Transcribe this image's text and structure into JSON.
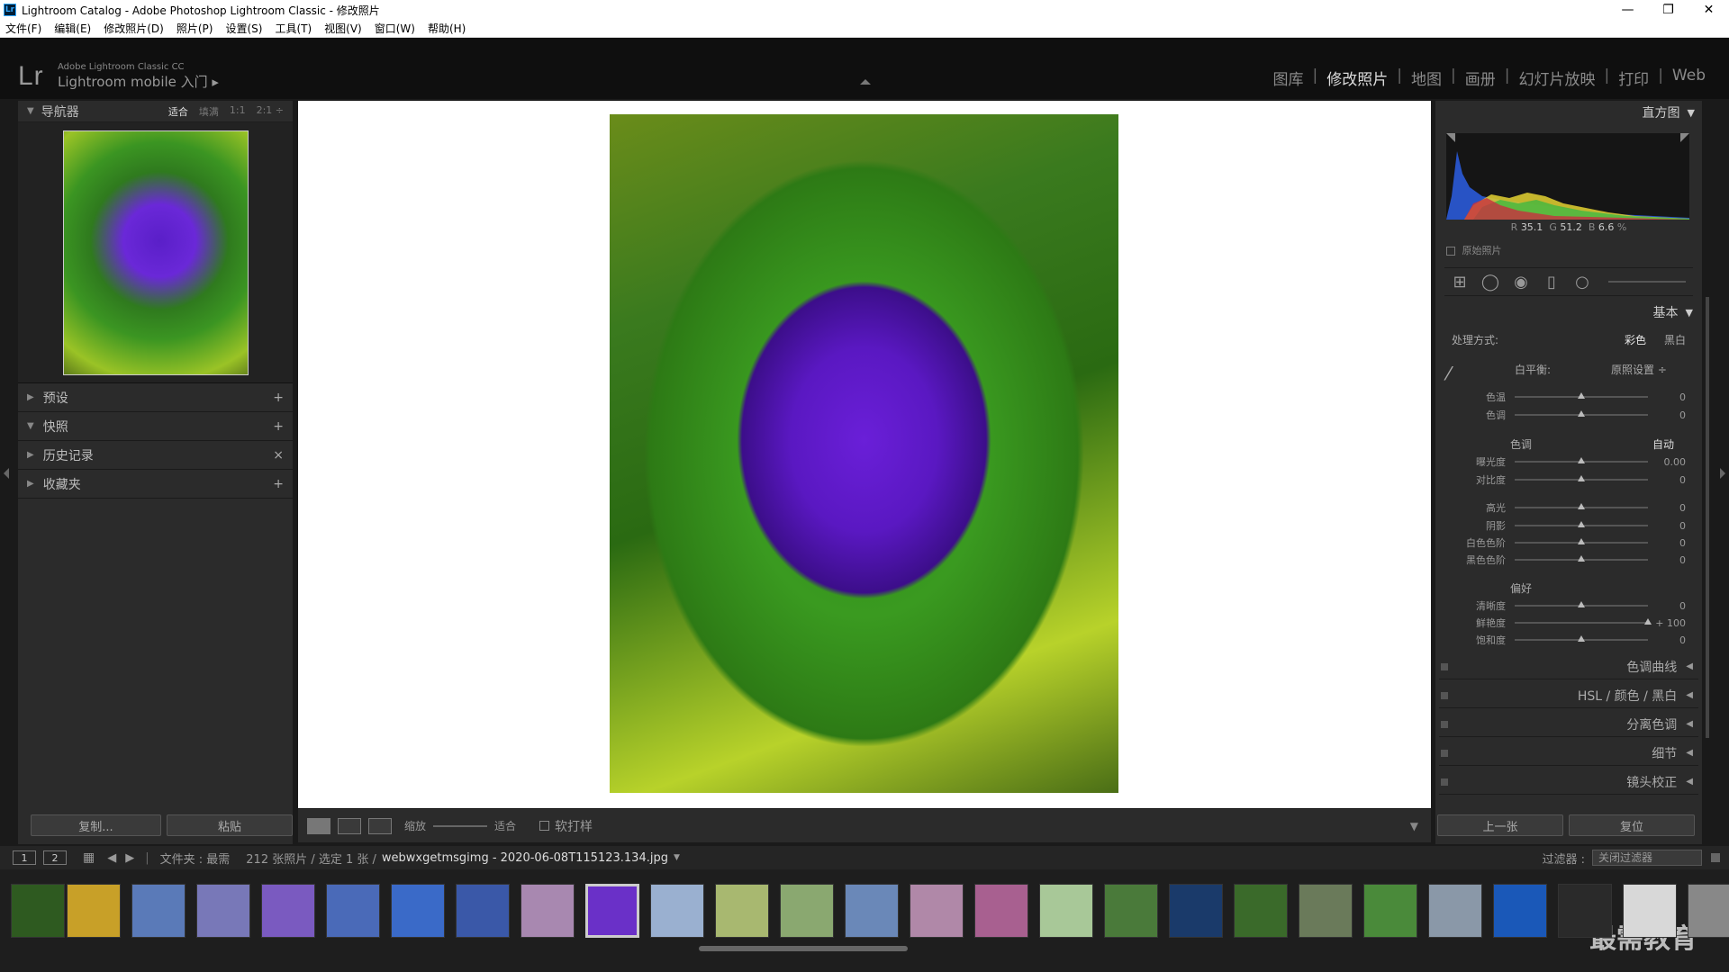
{
  "window": {
    "title": "Lightroom Catalog - Adobe Photoshop Lightroom Classic - 修改照片",
    "icon": "Lr",
    "controls": [
      "—",
      "❐",
      "✕"
    ]
  },
  "menu": [
    "文件(F)",
    "编辑(E)",
    "修改照片(D)",
    "照片(P)",
    "设置(S)",
    "工具(T)",
    "视图(V)",
    "窗口(W)",
    "帮助(H)"
  ],
  "identity": {
    "logo": "Lr",
    "line1": "Adobe Lightroom Classic CC",
    "line2": "Lightroom mobile 入门 ▸"
  },
  "modules": [
    "图库",
    "修改照片",
    "地图",
    "画册",
    "幻灯片放映",
    "打印",
    "Web"
  ],
  "active_module": "修改照片",
  "left": {
    "navigator": {
      "label": "导航器",
      "options": [
        "适合",
        "填满",
        "1:1",
        "2:1 ÷"
      ],
      "selected": "适合"
    },
    "panels": [
      {
        "label": "预设",
        "action": "+"
      },
      {
        "label": "快照",
        "action": "+"
      },
      {
        "label": "历史记录",
        "action": "×"
      },
      {
        "label": "收藏夹",
        "action": "+"
      }
    ],
    "copy_label": "复制...",
    "paste_label": "粘贴"
  },
  "toolbar": {
    "zoom_label": "缩放",
    "fit_label": "适合",
    "softproof_label": "软打样",
    "view_buttons": [
      "▭",
      "R|R",
      "Y|Y"
    ]
  },
  "right": {
    "histogram_label": "直方图",
    "hist_values": {
      "r_label": "R",
      "r": "35.1",
      "g_label": "G",
      "g": "51.2",
      "b_label": "B",
      "b": "6.6",
      "unit": "%"
    },
    "original_photo": "原始照片",
    "basic_label": "基本",
    "treatment_label": "处理方式:",
    "treatment_opts": [
      "彩色",
      "黑白"
    ],
    "treatment_selected": "彩色",
    "wb_label": "白平衡:",
    "wb_value": "原照设置 ÷",
    "tone_label": "色调",
    "auto_label": "自动",
    "presence_label": "偏好",
    "sliders": [
      {
        "label": "色温",
        "value": "0",
        "pos": 0.5
      },
      {
        "label": "色调",
        "value": "0",
        "pos": 0.5
      },
      {
        "label": "曝光度",
        "value": "0.00",
        "pos": 0.5
      },
      {
        "label": "对比度",
        "value": "0",
        "pos": 0.5
      },
      {
        "label": "高光",
        "value": "0",
        "pos": 0.5
      },
      {
        "label": "阴影",
        "value": "0",
        "pos": 0.5
      },
      {
        "label": "白色色阶",
        "value": "0",
        "pos": 0.5
      },
      {
        "label": "黑色色阶",
        "value": "0",
        "pos": 0.5
      },
      {
        "label": "清晰度",
        "value": "0",
        "pos": 0.5
      },
      {
        "label": "鲜艳度",
        "value": "+ 100",
        "pos": 1.0
      },
      {
        "label": "饱和度",
        "value": "0",
        "pos": 0.5
      }
    ],
    "collapsed_panels": [
      "色调曲线",
      "HSL / 颜色 / 黑白",
      "分离色调",
      "细节",
      "镜头校正"
    ],
    "prev_label": "上一张",
    "reset_label": "复位"
  },
  "filmstrip": {
    "view1": "1",
    "view2": "2",
    "source": "文件夹 : 最需",
    "count": "212 张照片 / 选定 1 张 /",
    "filename": "webwxgetmsgimg - 2020-06-08T115123.134.jpg",
    "filter_label": "过滤器 :",
    "filter_value": "关闭过滤器",
    "thumb_colors": [
      "#2e5a20",
      "#c8a028",
      "#5a7ab8",
      "#7878b8",
      "#7a5ac0",
      "#4a6ab8",
      "#3a6ac8",
      "#3a58a8",
      "#a888b0",
      "#6a30c8",
      "#9ab0d0",
      "#a8b870",
      "#8aa870",
      "#6a88b8",
      "#b088a8",
      "#a86090",
      "#a8c898",
      "#4a7a3a",
      "#1a3a6a",
      "#3a6a2a",
      "#6a7a5a",
      "#4a8a3a",
      "#8a98a8",
      "#1a58b8",
      "#2a2a2a",
      "#d8d8d8",
      "#888888"
    ]
  },
  "watermark": "最需教育"
}
